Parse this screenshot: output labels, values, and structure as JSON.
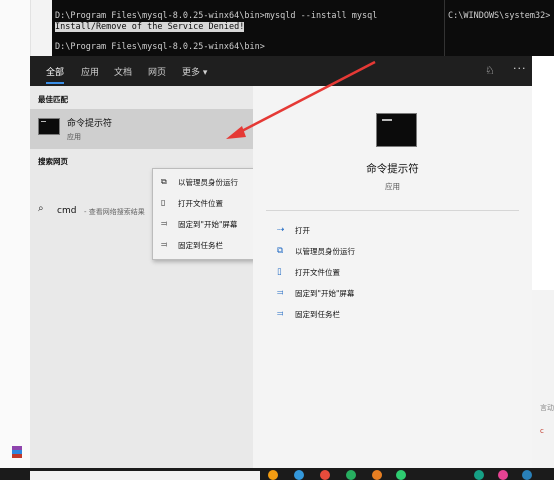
{
  "console": {
    "line1": "D:\\Program Files\\mysql-8.0.25-winx64\\bin>mysqld --install mysql",
    "line2": "Install/Remove of the Service Denied!",
    "line3": "D:\\Program Files\\mysql-8.0.25-winx64\\bin>",
    "right_path": "C:\\WINDOWS\\system32>"
  },
  "tabs": [
    {
      "label": "全部",
      "active": true
    },
    {
      "label": "应用"
    },
    {
      "label": "文档"
    },
    {
      "label": "网页"
    },
    {
      "label": "更多 ▾"
    }
  ],
  "best_match": {
    "header": "最佳匹配",
    "name": "命令提示符",
    "type": "应用"
  },
  "web_search": {
    "header": "搜索网页",
    "query": "cmd",
    "hint": " - 查看网络搜索结果"
  },
  "context_menu": [
    {
      "icon": "run-as-admin-icon",
      "label": "以管理员身份运行"
    },
    {
      "icon": "open-file-location-icon",
      "label": "打开文件位置"
    },
    {
      "icon": "pin-icon",
      "label": "固定到\"开始\"屏幕"
    },
    {
      "icon": "pin-icon",
      "label": "固定到任务栏"
    }
  ],
  "detail": {
    "name": "命令提示符",
    "type": "应用",
    "actions": [
      {
        "icon": "open-icon",
        "label": "打开"
      },
      {
        "icon": "run-as-admin-icon",
        "label": "以管理员身份运行"
      },
      {
        "icon": "open-file-location-icon",
        "label": "打开文件位置"
      },
      {
        "icon": "pin-icon",
        "label": "固定到\"开始\"屏幕"
      },
      {
        "icon": "pin-icon",
        "label": "固定到任务栏"
      }
    ]
  },
  "colors": {
    "accent": "#3a8ee6",
    "arrow": "#e53935",
    "panel_dark": "#2b2b2b"
  }
}
